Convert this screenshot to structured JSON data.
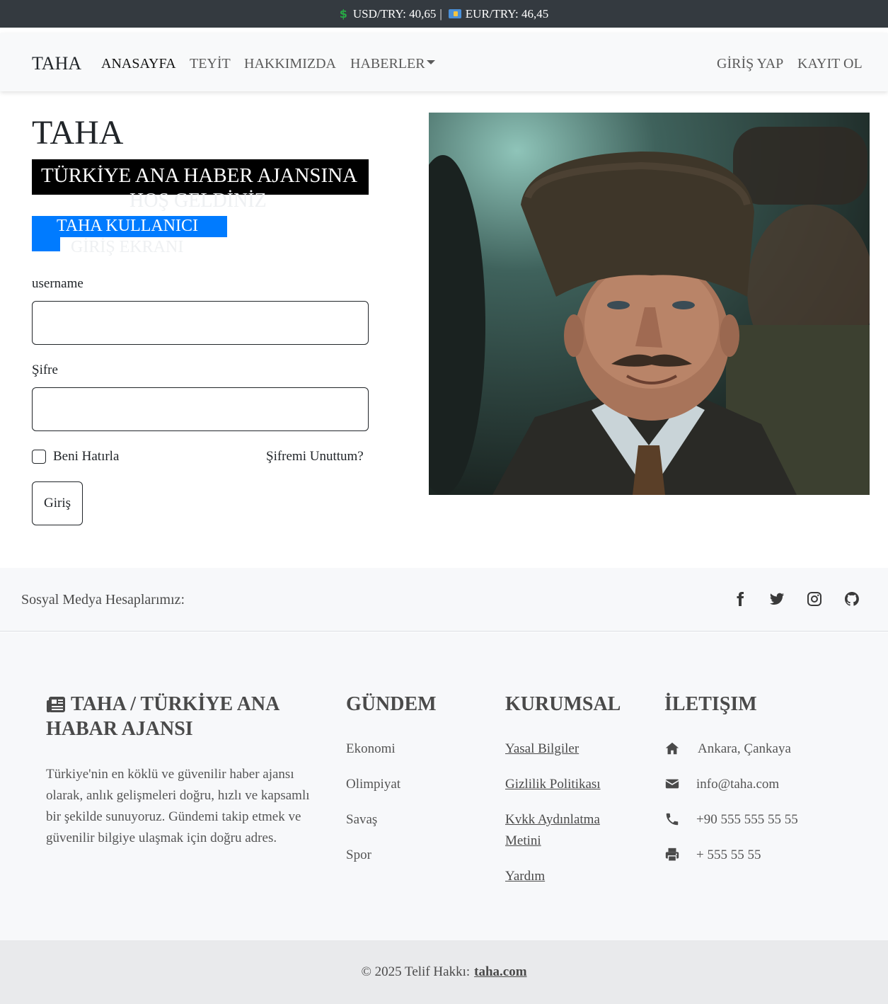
{
  "currency": {
    "usd_label": "USD/TRY: 40,65",
    "separator": "|",
    "eur_label": "EUR/TRY: 46,45"
  },
  "navbar": {
    "brand": "TAHA",
    "links": [
      "ANASAYFA",
      "TEYİT",
      "HAKKIMIZDA",
      "HABERLER"
    ],
    "right_links": [
      "GİRİŞ YAP",
      "KAYIT OL"
    ]
  },
  "hero": {
    "title": "TAHA",
    "welcome": "TÜRKİYE ANA HABER AJANSINA",
    "welcome_sub": "HOŞ GELDİNİZ",
    "user_title": "TAHA KULLANICI",
    "user_sub": "GİRİŞ EKRANI"
  },
  "form": {
    "username_label": "username",
    "password_label": "Şifre",
    "remember_label": "Beni Hatırla",
    "forgot_label": "Şifremi Unuttum?",
    "submit_label": "Giriş"
  },
  "social": {
    "label": "Sosyal Medya Hesaplarımız:",
    "icons": [
      "facebook-icon",
      "twitter-icon",
      "instagram-icon",
      "github-icon"
    ]
  },
  "footer": {
    "about_title_line1": "TAHA / TÜRKİYE ANA",
    "about_title_line2": "HABAR AJANSI",
    "about_desc": "Türkiye'nin en köklü ve güvenilir haber ajansı olarak, anlık gelişmeleri doğru, hızlı ve kapsamlı bir şekilde sunuyoruz. Gündemi takip etmek ve güvenilir bilgiye ulaşmak için doğru adres.",
    "gundem_title": "GÜNDEM",
    "gundem_items": [
      "Ekonomi",
      "Olimpiyat",
      "Savaş",
      "Spor"
    ],
    "kurumsal_title": "KURUMSAL",
    "kurumsal_items": [
      "Yasal Bilgiler",
      "Gizlilik Politikası",
      "Kvkk Aydınlatma Metini",
      "Yardım"
    ],
    "iletisim_title": "İLETIŞIM",
    "iletisim_items": [
      "Ankara, Çankaya",
      "info@taha.com",
      "+90 555 555 55 55",
      "+ 555 55 55"
    ],
    "copyright_text": "© 2025 Telif Hakkı:",
    "copyright_link": "taha.com"
  },
  "colors": {
    "currency_bg": "#343a40",
    "navbar_bg": "#f8f9fa",
    "accent_blue": "#007bff",
    "welcome_bg": "#000000",
    "footer_bg": "#f7f8fa",
    "copyright_bg": "#e9eaec"
  }
}
